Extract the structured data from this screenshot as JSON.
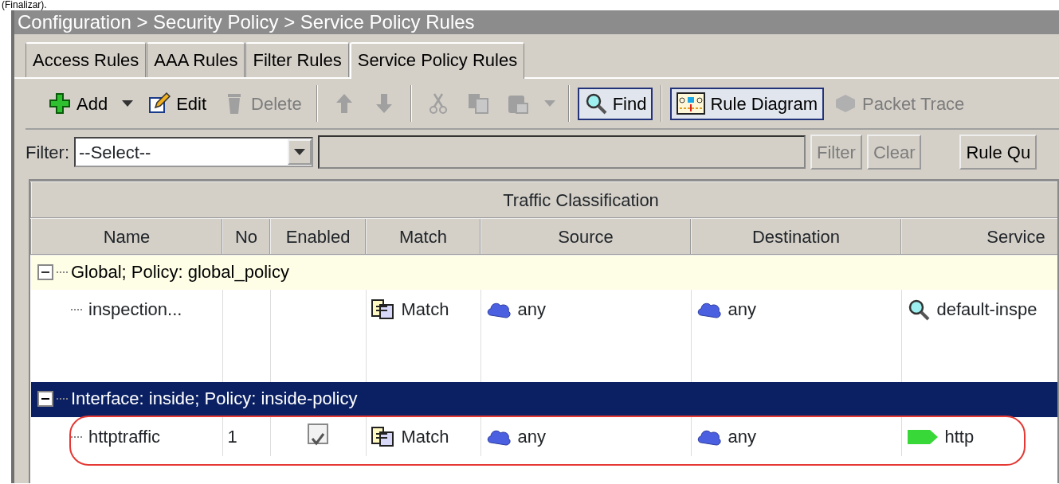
{
  "caption_fragment": "(Finalizar).",
  "breadcrumb": "Configuration > Security Policy > Service Policy Rules",
  "tabs": [
    {
      "label": "Access Rules",
      "selected": false
    },
    {
      "label": "AAA Rules",
      "selected": false
    },
    {
      "label": "Filter Rules",
      "selected": false
    },
    {
      "label": "Service Policy Rules",
      "selected": true
    }
  ],
  "toolbar": [
    {
      "kind": "add",
      "label": "Add",
      "disabled": false,
      "highlighted": false
    },
    {
      "kind": "caret",
      "disabled": false
    },
    {
      "kind": "edit",
      "label": "Edit",
      "disabled": false,
      "highlighted": false
    },
    {
      "kind": "delete",
      "label": "Delete",
      "disabled": true,
      "highlighted": false
    },
    {
      "kind": "separator"
    },
    {
      "kind": "moveup",
      "disabled": true,
      "highlighted": false
    },
    {
      "kind": "movedown",
      "disabled": true,
      "highlighted": false
    },
    {
      "kind": "separator"
    },
    {
      "kind": "cut",
      "disabled": true,
      "highlighted": false
    },
    {
      "kind": "copy",
      "disabled": true,
      "highlighted": false
    },
    {
      "kind": "paste",
      "disabled": true,
      "highlighted": false
    },
    {
      "kind": "caret",
      "disabled": true
    },
    {
      "kind": "separator"
    },
    {
      "kind": "find",
      "label": "Find",
      "disabled": false,
      "highlighted": true
    },
    {
      "kind": "separator"
    },
    {
      "kind": "diagram",
      "label": "Rule Diagram",
      "disabled": false,
      "highlighted": true
    },
    {
      "kind": "trace",
      "label": "Packet Trace",
      "disabled": true,
      "highlighted": false
    }
  ],
  "filter": {
    "label": "Filter:",
    "select_value": "--Select--",
    "buttons": [
      {
        "label": "Filter",
        "disabled": true
      },
      {
        "label": "Clear",
        "disabled": true
      },
      {
        "label": "Rule Qu",
        "disabled": false
      }
    ]
  },
  "table": {
    "group_header": "Traffic Classification",
    "columns": [
      "Name",
      "No",
      "Enabled",
      "Match",
      "Source",
      "Destination",
      "Service"
    ],
    "groups": [
      {
        "label": "Global; Policy: global_policy",
        "expanded": true,
        "selected": false,
        "rows": [
          {
            "name": "inspection...",
            "match": "Match",
            "source": "any",
            "destination": "any",
            "service": {
              "kind": "inspect",
              "text": "default-inspe"
            },
            "annotated": false
          }
        ]
      },
      {
        "label": "Interface: inside; Policy: inside-policy",
        "expanded": true,
        "selected": true,
        "rows": [
          {
            "name": "httptraffic",
            "no": "1",
            "enabled": {
              "checked": true
            },
            "match": "Match",
            "source": "any",
            "destination": "any",
            "service": {
              "kind": "tcp",
              "text": "http"
            },
            "annotated": true
          }
        ]
      }
    ]
  }
}
